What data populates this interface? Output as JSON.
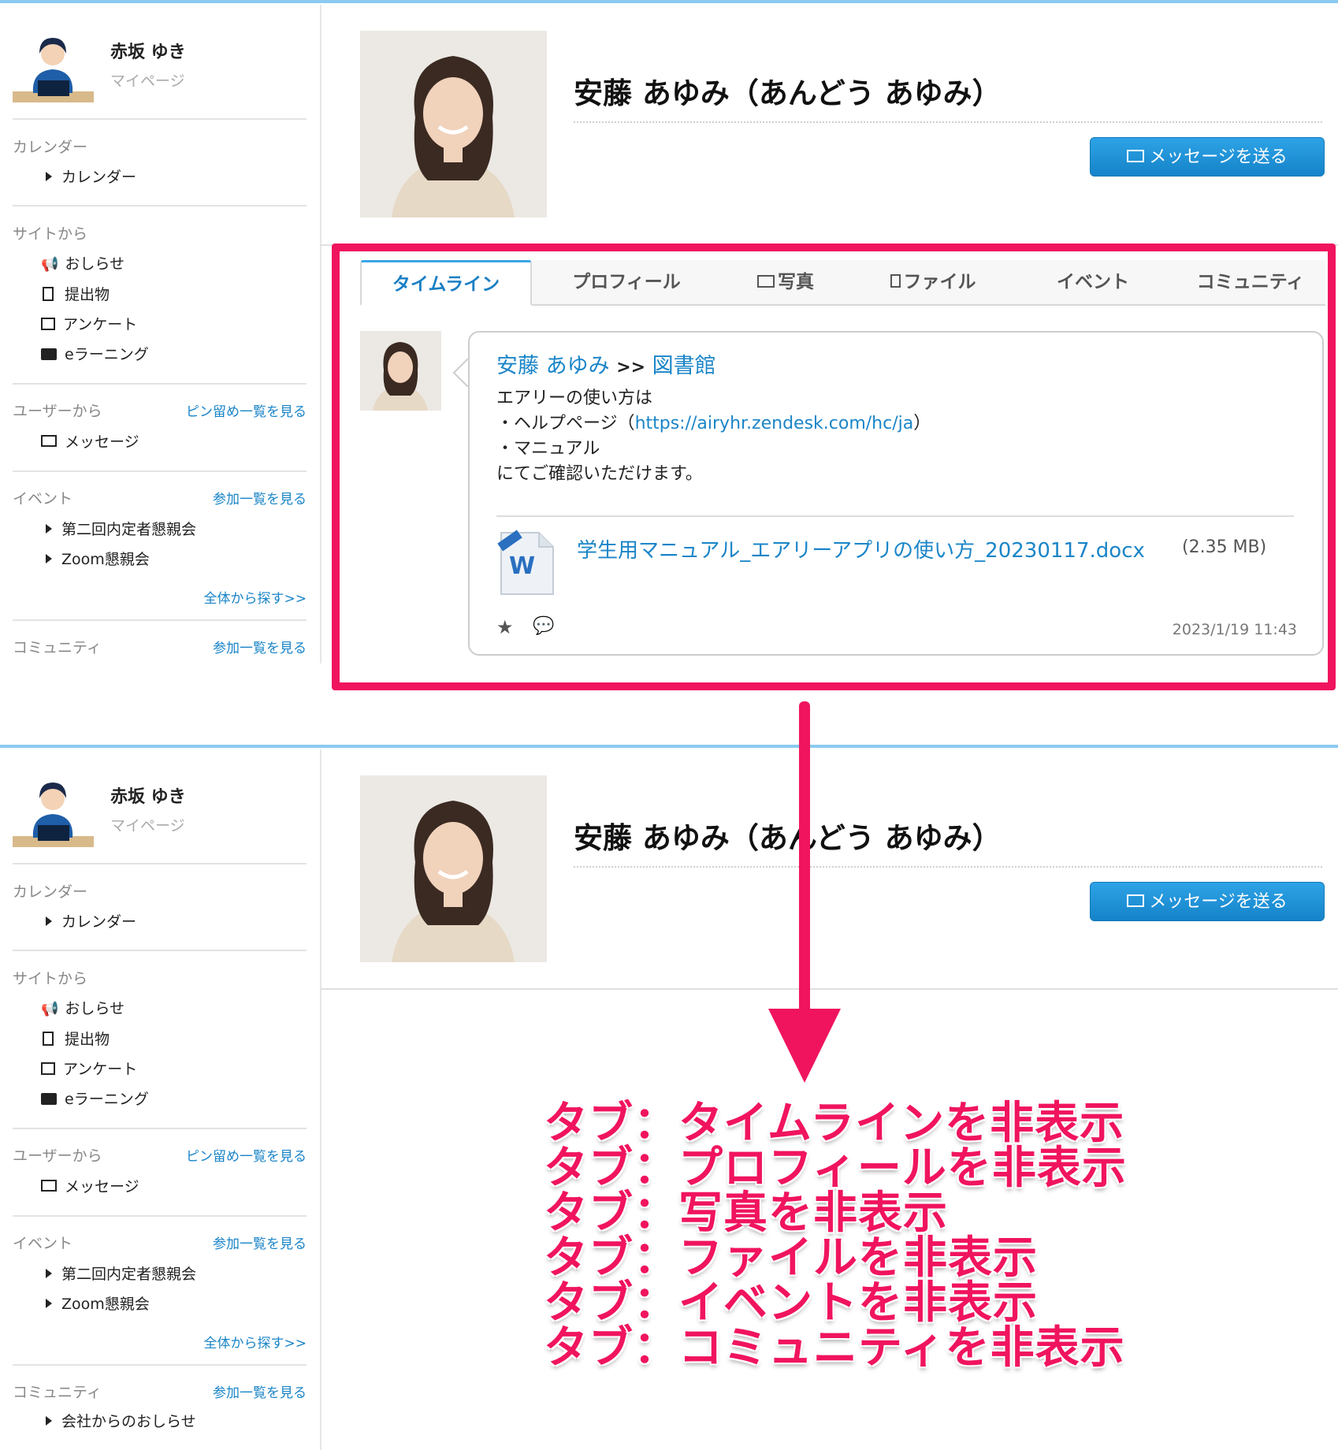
{
  "sidebar": {
    "user_name": "赤坂 ゆき",
    "mypage": "マイページ",
    "sections": {
      "calendar": {
        "title": "カレンダー",
        "items": [
          "カレンダー"
        ]
      },
      "site": {
        "title": "サイトから",
        "items": [
          "おしらせ",
          "提出物",
          "アンケート",
          "eラーニング"
        ]
      },
      "user": {
        "title": "ユーザーから",
        "link": "ピン留め一覧を見る",
        "items": [
          "メッセージ"
        ]
      },
      "event": {
        "title": "イベント",
        "link": "参加一覧を見る",
        "items": [
          "第二回内定者懇親会",
          "Zoom懇親会"
        ],
        "footer_link": "全体から探す>>"
      },
      "community": {
        "title": "コミュニティ",
        "link": "参加一覧を見る",
        "items": [
          "会社からのおしらせ"
        ]
      }
    }
  },
  "profile": {
    "name": "安藤 あゆみ（あんどう あゆみ）",
    "message_button": "メッセージを送る"
  },
  "tabs": [
    "タイムライン",
    "プロフィール",
    "写真",
    "ファイル",
    "イベント",
    "コミュニティ"
  ],
  "post": {
    "author": "安藤 あゆみ",
    "arrow": ">>",
    "target": "図書館",
    "body_lines": [
      "エアリーの使い方は",
      "・ヘルプページ（",
      "・マニュアル",
      "にてご確認いただけます。"
    ],
    "link": "https://airyhr.zendesk.com/hc/ja",
    "link_close": "）",
    "file_name": "学生用マニュアル_エアリーアプリの使い方_20230117.docx",
    "file_size": "(2.35 MB)",
    "timestamp": "2023/1/19 11:43"
  },
  "annotations": [
    "タブ：タイムラインを非表示",
    "タブ：プロフィールを非表示",
    "タブ：写真を非表示",
    "タブ：ファイルを非表示",
    "タブ：イベントを非表示",
    "タブ：コミュニティを非表示"
  ],
  "colors": {
    "accent": "#f0145e",
    "link": "#1a85c8",
    "top_border": "#8ccaf0"
  }
}
